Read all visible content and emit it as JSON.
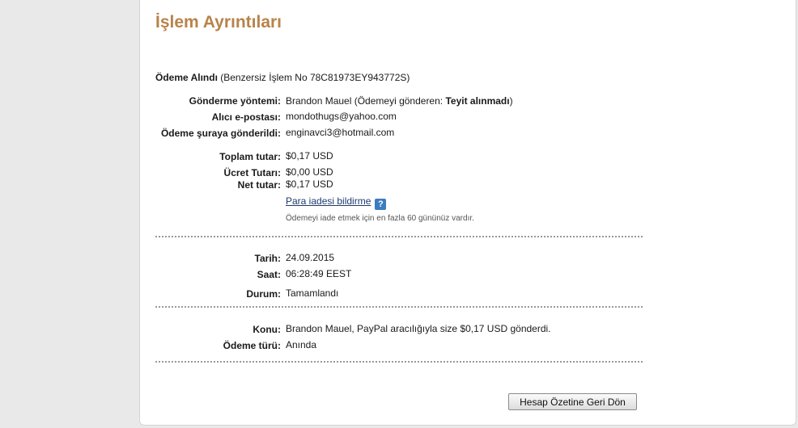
{
  "page": {
    "title": "İşlem Ayrıntıları"
  },
  "receipt": {
    "heading": "Ödeme Alındı",
    "transaction_id": "(Benzersiz İşlem No 78C81973EY943772S)"
  },
  "sender": {
    "method_label": "Gönderme yöntemi:",
    "method_value": "Brandon Mauel (Ödemeyi gönderen: ",
    "method_status": "Teyit alınmadı",
    "method_close": ")",
    "recipient_label": "Alıcı e-postası:",
    "recipient_value": "mondothugs@yahoo.com",
    "sent_to_label": "Ödeme şuraya gönderildi:",
    "sent_to_value": "enginavci3@hotmail.com"
  },
  "amounts": {
    "total_label": "Toplam tutar:",
    "total_value": "$0,17 USD",
    "fee_label": "Ücret Tutarı:",
    "fee_value": "$0,00 USD",
    "net_label": "Net tutar:",
    "net_value": "$0,17 USD",
    "refund_link": "Para iadesi bildirme",
    "help_icon": "question-icon",
    "help_symbol": "?",
    "refund_hint": "Ödemeyi iade etmek için en fazla 60 gününüz vardır."
  },
  "datetime": {
    "date_label": "Tarih:",
    "date_value": "24.09.2015",
    "time_label": "Saat:",
    "time_value": "06:28:49 EEST",
    "status_label": "Durum:",
    "status_value": "Tamamlandı"
  },
  "details": {
    "subject_label": "Konu:",
    "subject_value": "Brandon Mauel, PayPal aracılığıyla size $0,17 USD gönderdi.",
    "type_label": "Ödeme türü:",
    "type_value": "Anında"
  },
  "actions": {
    "back_button": "Hesap Özetine Geri Dön"
  },
  "colors": {
    "title": "#b8834a",
    "link": "#1e3a6e",
    "help_icon": "#3c7cc0"
  }
}
